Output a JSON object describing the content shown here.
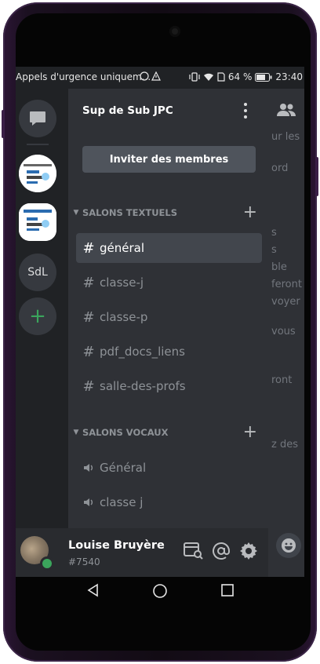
{
  "status_bar": {
    "notification_text": "Appels d'urgence uniquem...",
    "battery": "64 %",
    "time": "23:40"
  },
  "server": {
    "name": "Sup de Sub JPC",
    "invite_label": "Inviter des membres"
  },
  "guilds": [
    {
      "label": "",
      "icon": "campus-guild-icon"
    },
    {
      "label": "",
      "icon": "campus-guild-icon-2"
    },
    {
      "label": "SdL",
      "icon": "text"
    },
    {
      "label": "+",
      "icon": "add-server-icon"
    }
  ],
  "categories": {
    "text": "SALONS TEXTUELS",
    "voice": "SALONS VOCAUX"
  },
  "text_channels": [
    {
      "name": "général",
      "active": true
    },
    {
      "name": "classe-j",
      "active": false
    },
    {
      "name": "classe-p",
      "active": false
    },
    {
      "name": "pdf_docs_liens",
      "active": false
    },
    {
      "name": "salle-des-profs",
      "active": false,
      "locked": true
    }
  ],
  "voice_channels": [
    {
      "name": "Général"
    },
    {
      "name": "classe j"
    }
  ],
  "user": {
    "name": "Louise Bruyère",
    "tag": "#7540",
    "status_color": "#3ba55c"
  },
  "background_chat_fragments": [
    "ur les",
    "ord",
    "s",
    "s",
    "ble",
    "feront",
    "voyer",
    "vous",
    "ront",
    "z des"
  ],
  "colors": {
    "sidebar": "#2f3136",
    "guildbar": "#202225",
    "active_channel": "#42464d",
    "online": "#3ba55c"
  }
}
